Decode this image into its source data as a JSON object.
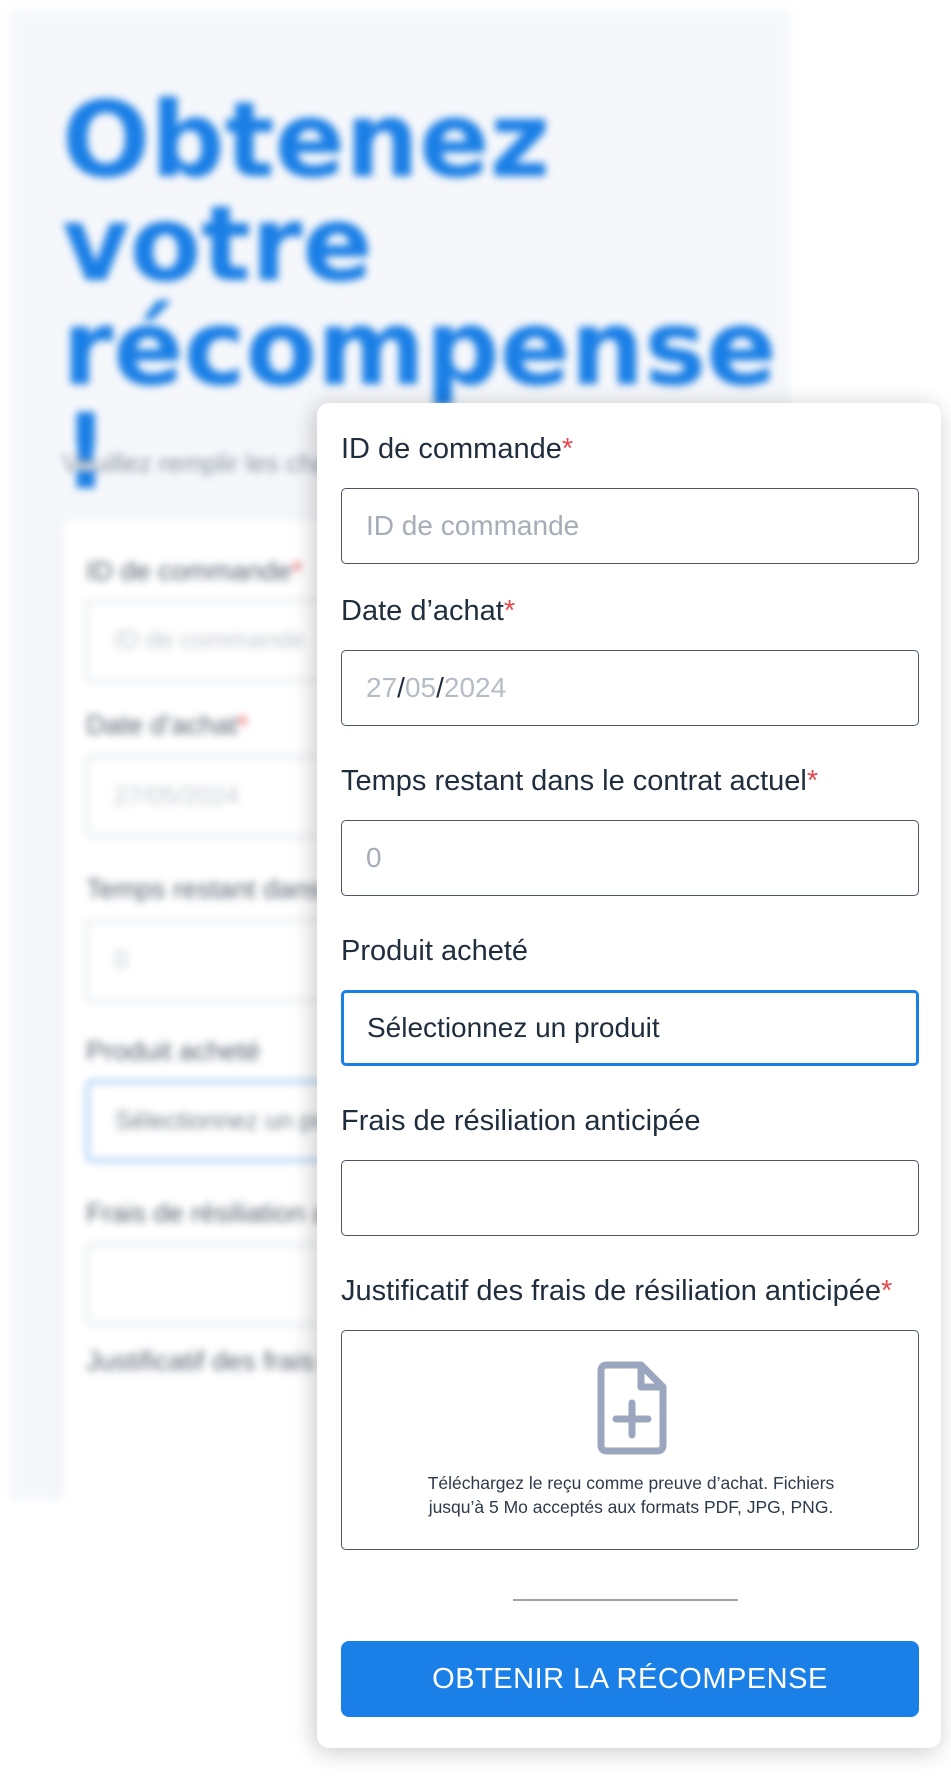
{
  "page": {
    "title": "Obtenez votre récompense !",
    "subtitle": "Veuillez remplir les champs"
  },
  "form": {
    "required_marker": "*",
    "order_id": {
      "label": "ID de commande",
      "placeholder": "ID de commande"
    },
    "purchase_date": {
      "label": "Date d’achat",
      "day": "27",
      "month": "05",
      "year": "2024",
      "separator": "/"
    },
    "remaining_time": {
      "label": "Temps restant dans le contrat actuel",
      "placeholder": "0"
    },
    "product": {
      "label": "Produit acheté",
      "value": "Sélectionnez un produit"
    },
    "early_fee": {
      "label": "Frais de résiliation anticipée",
      "value": ""
    },
    "fee_proof": {
      "label": "Justificatif des frais de résiliation anticipée",
      "icon": "file-plus-icon",
      "help_line1": "Téléchargez le reçu comme preuve d’achat. Fichiers",
      "help_line2": "jusqu’à 5 Mo acceptés aux formats PDF, JPG, PNG."
    },
    "submit_label": "OBTENIR LA RÉCOMPENSE"
  },
  "colors": {
    "accent": "#1a7fe6",
    "required": "#e5484d",
    "text": "#1f2d3d",
    "icon": "#9aa6bd"
  }
}
